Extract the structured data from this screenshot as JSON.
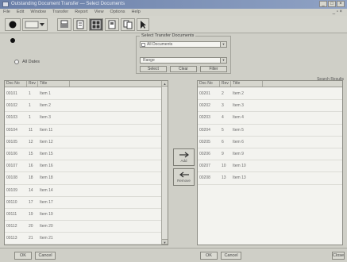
{
  "window": {
    "title": "Outstanding Document Transfer — Select Documents",
    "buttons": [
      "_",
      "□",
      "×"
    ]
  },
  "menu": {
    "items": [
      "File",
      "Edit",
      "Window",
      "Transfer",
      "Report",
      "View",
      "Options",
      "Help"
    ],
    "mdi_control": "_ ▫ ×"
  },
  "filter": {
    "radio_label": "All Dates",
    "group_title": "Select Transfer Documents",
    "combo1": "All Documents",
    "combo2": "Range",
    "btn_select": "Select",
    "btn_clear": "Clear",
    "btn_filter": "Filter"
  },
  "right_label": "Search Results",
  "left_list": {
    "headers": [
      "Doc No",
      "Rev",
      "Title"
    ],
    "rows": [
      [
        "00101",
        "1",
        "Item 1"
      ],
      [
        "00102",
        "1",
        "Item 2"
      ],
      [
        "00103",
        "1",
        "Item 3"
      ],
      [
        "00104",
        "11",
        "Item 11"
      ],
      [
        "00105",
        "12",
        "Item 12"
      ],
      [
        "00106",
        "15",
        "Item 15"
      ],
      [
        "00107",
        "16",
        "Item 16"
      ],
      [
        "00108",
        "18",
        "Item 18"
      ],
      [
        "00109",
        "14",
        "Item 14"
      ],
      [
        "00110",
        "17",
        "Item 17"
      ],
      [
        "00111",
        "19",
        "Item 19"
      ],
      [
        "00112",
        "20",
        "Item 20"
      ],
      [
        "00113",
        "21",
        "Item 21"
      ]
    ]
  },
  "right_list": {
    "headers": [
      "Doc No",
      "Rev",
      "Title"
    ],
    "rows": [
      [
        "00201",
        "2",
        "Item 2"
      ],
      [
        "00202",
        "3",
        "Item 3"
      ],
      [
        "00203",
        "4",
        "Item 4"
      ],
      [
        "00204",
        "5",
        "Item 5"
      ],
      [
        "00205",
        "6",
        "Item 6"
      ],
      [
        "00206",
        "9",
        "Item 9"
      ],
      [
        "00207",
        "10",
        "Item 10"
      ],
      [
        "00208",
        "13",
        "Item 13"
      ]
    ]
  },
  "transfer": {
    "add_label": "Add",
    "remove_label": "Remove"
  },
  "bottom": {
    "ok": "OK",
    "cancel": "Cancel",
    "ok2": "OK",
    "cancel2": "Cancel",
    "close": "Close"
  }
}
